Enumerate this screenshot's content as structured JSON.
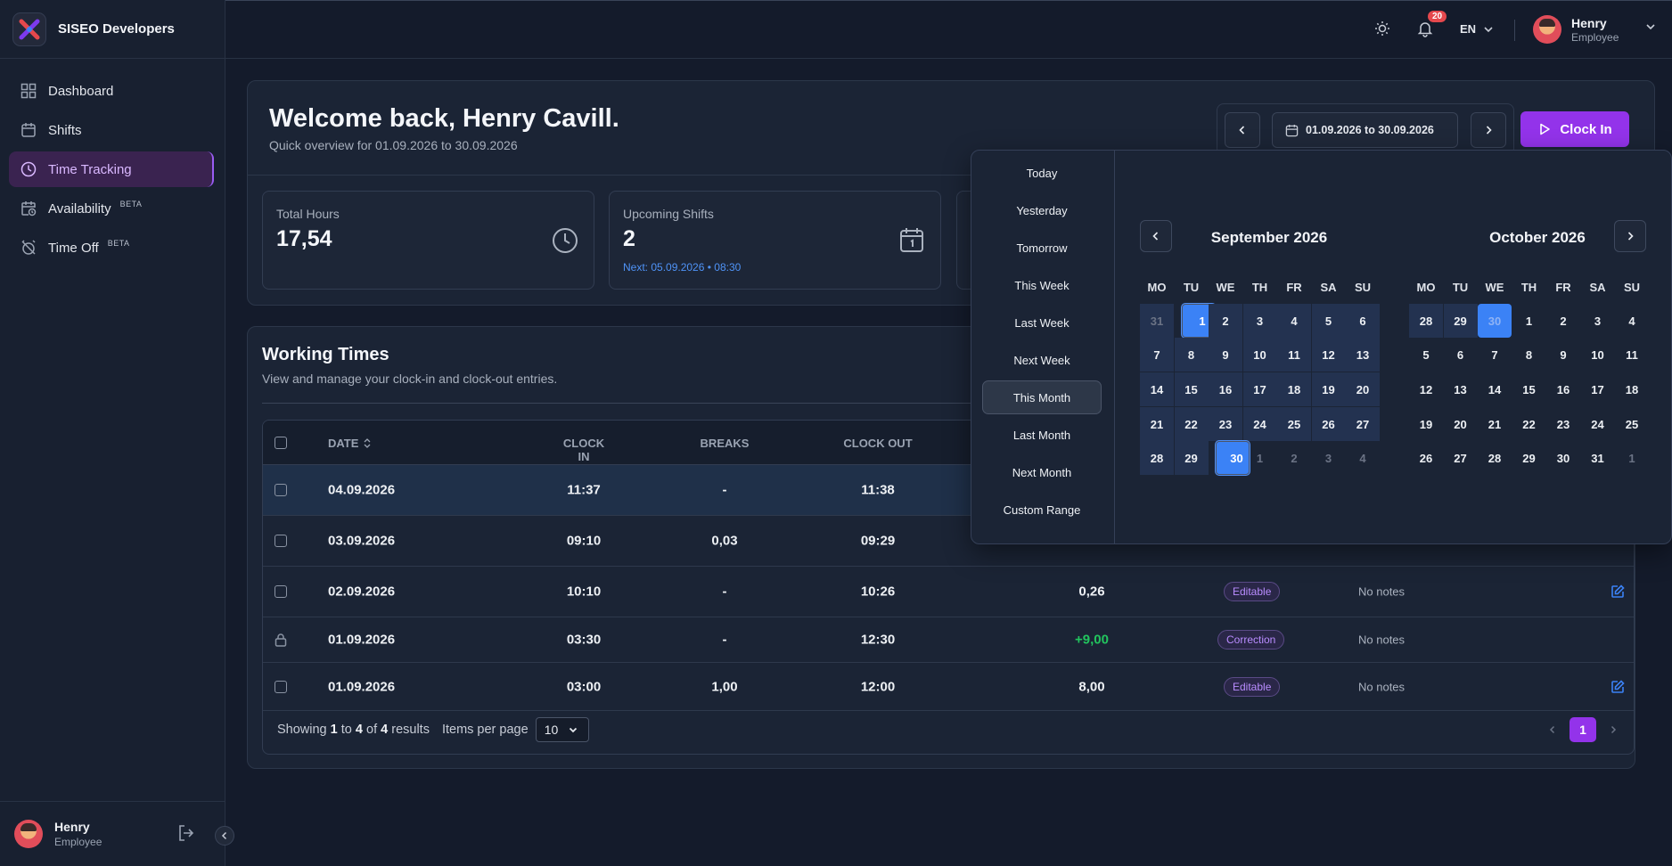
{
  "brand": {
    "name": "SISEO Developers"
  },
  "sidebar": {
    "items": [
      {
        "label": "Dashboard",
        "icon": "dashboard-icon"
      },
      {
        "label": "Shifts",
        "icon": "calendar-icon"
      },
      {
        "label": "Time Tracking",
        "icon": "clock-icon",
        "active": true
      },
      {
        "label": "Availability",
        "icon": "calendar-clock-icon",
        "badge": "BETA"
      },
      {
        "label": "Time Off",
        "icon": "alarm-off-icon",
        "badge": "BETA"
      }
    ],
    "user": {
      "name": "Henry",
      "role": "Employee"
    }
  },
  "topbar": {
    "notifications": "20",
    "language": "EN",
    "user": {
      "name": "Henry",
      "role": "Employee"
    }
  },
  "welcome": {
    "title": "Welcome back, Henry Cavill.",
    "subtitle": "Quick overview for 01.09.2026 to 30.09.2026",
    "date_range": "01.09.2026 to 30.09.2026",
    "clock_in_label": "Clock In"
  },
  "stats": [
    {
      "label": "Total Hours",
      "value": "17,54"
    },
    {
      "label": "Upcoming Shifts",
      "value": "2",
      "extra": "Next: 05.09.2026 • 08:30"
    }
  ],
  "working_times": {
    "title": "Working Times",
    "subtitle": "View and manage your clock-in and clock-out entries.",
    "columns": {
      "date": "DATE",
      "clock_in": "CLOCK IN",
      "breaks": "BREAKS",
      "clock_out": "CLOCK OUT"
    },
    "rows": [
      {
        "date": "04.09.2026",
        "clock_in": "11:37",
        "breaks": "-",
        "clock_out": "11:38"
      },
      {
        "date": "03.09.2026",
        "clock_in": "09:10",
        "breaks": "0,03",
        "clock_out": "09:29"
      },
      {
        "date": "02.09.2026",
        "clock_in": "10:10",
        "breaks": "-",
        "clock_out": "10:26",
        "hours": "0,26",
        "status": "Editable",
        "notes": "No notes"
      },
      {
        "date": "01.09.2026",
        "clock_in": "03:30",
        "breaks": "-",
        "clock_out": "12:30",
        "hours": "+9,00",
        "status": "Correction",
        "notes": "No notes",
        "locked": true
      },
      {
        "date": "01.09.2026",
        "clock_in": "03:00",
        "breaks": "1,00",
        "clock_out": "12:00",
        "hours": "8,00",
        "status": "Editable",
        "notes": "No notes"
      }
    ],
    "footer": {
      "showing": "Showing",
      "from": "1",
      "to_word": "to",
      "to": "4",
      "of_word": "of",
      "total": "4",
      "results": "results",
      "per_page_label": "Items per page",
      "per_page": "10",
      "page": "1"
    }
  },
  "date_picker": {
    "presets": [
      "Today",
      "Yesterday",
      "Tomorrow",
      "This Week",
      "Last Week",
      "Next Week",
      "This Month",
      "Last Month",
      "Next Month",
      "Custom Range"
    ],
    "active_preset": "This Month",
    "weekdays": [
      "MO",
      "TU",
      "WE",
      "TH",
      "FR",
      "SA",
      "SU"
    ],
    "months": [
      {
        "title": "September 2026",
        "weeks": [
          [
            "31",
            "1",
            "2",
            "3",
            "4",
            "5",
            "6"
          ],
          [
            "7",
            "8",
            "9",
            "10",
            "11",
            "12",
            "13"
          ],
          [
            "14",
            "15",
            "16",
            "17",
            "18",
            "19",
            "20"
          ],
          [
            "21",
            "22",
            "23",
            "24",
            "25",
            "26",
            "27"
          ],
          [
            "28",
            "29",
            "30",
            "1",
            "2",
            "3",
            "4"
          ]
        ]
      },
      {
        "title": "October 2026",
        "weeks": [
          [
            "28",
            "29",
            "30",
            "1",
            "2",
            "3",
            "4"
          ],
          [
            "5",
            "6",
            "7",
            "8",
            "9",
            "10",
            "11"
          ],
          [
            "12",
            "13",
            "14",
            "15",
            "16",
            "17",
            "18"
          ],
          [
            "19",
            "20",
            "21",
            "22",
            "23",
            "24",
            "25"
          ],
          [
            "26",
            "27",
            "28",
            "29",
            "30",
            "31",
            "1"
          ]
        ]
      }
    ]
  },
  "colors": {
    "accent": "#9333ea",
    "selection": "#3b82f6",
    "positive": "#22c55e"
  }
}
